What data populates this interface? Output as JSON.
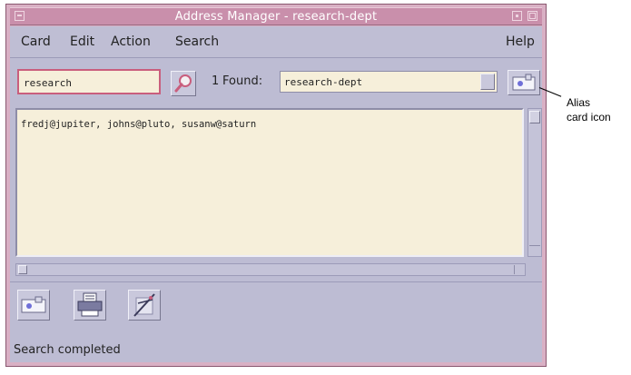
{
  "window": {
    "title": "Address Manager - research-dept"
  },
  "menu": {
    "items": [
      "Card",
      "Edit",
      "Action",
      "Search"
    ],
    "help": "Help"
  },
  "search": {
    "query": "research",
    "found_count": "1",
    "found_label": "Found:",
    "found_value": "research-dept"
  },
  "content": {
    "text": "fredj@jupiter, johns@pluto, susanw@saturn"
  },
  "status": {
    "text": "Search completed"
  },
  "callout": {
    "line1": "Alias",
    "line2": "card icon"
  },
  "icons": {
    "search_button": "magnifier-icon",
    "alias_card": "alias-card-icon",
    "toolbar": [
      "card-icon",
      "print-icon",
      "delete-icon"
    ]
  },
  "colors": {
    "title_bar": "#c98fab",
    "window_frame": "#d9b0c4",
    "panel": "#bdbcd3",
    "field_background": "#f6efda",
    "focus_border": "#c95e7d"
  }
}
